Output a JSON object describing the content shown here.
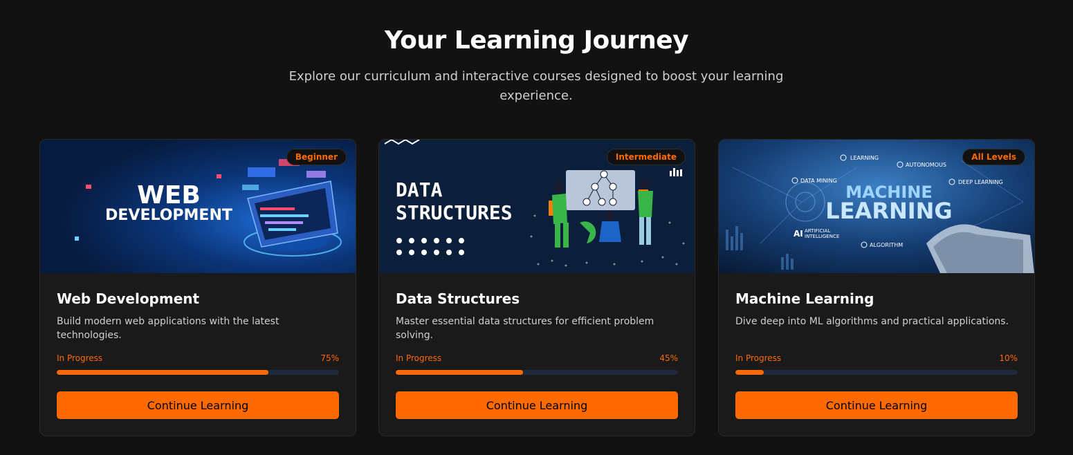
{
  "header": {
    "title": "Your Learning Journey",
    "subtitle": "Explore our curriculum and interactive courses designed to boost your learning experience."
  },
  "courses": [
    {
      "level": "Beginner",
      "image_text": [
        "WEB",
        "DEVELOPMENT"
      ],
      "title": "Web Development",
      "description": "Build modern web applications with the latest technologies.",
      "status": "In Progress",
      "progress_text": "75%",
      "progress": 0.75,
      "button": "Continue Learning"
    },
    {
      "level": "Intermediate",
      "image_text": [
        "DATA",
        "STRUCTURES"
      ],
      "title": "Data Structures",
      "description": "Master essential data structures for efficient problem solving.",
      "status": "In Progress",
      "progress_text": "45%",
      "progress": 0.45,
      "button": "Continue Learning"
    },
    {
      "level": "All Levels",
      "image_text": [
        "MACHINE",
        "LEARNING",
        "LEARNING",
        "AUTONOMOUS",
        "DATA MINING",
        "DEEP LEARNING",
        "ARTIFICIAL",
        "INTELLIGENCE",
        "ALGORITHM",
        "AI"
      ],
      "title": "Machine Learning",
      "description": "Dive deep into ML algorithms and practical applications.",
      "status": "In Progress",
      "progress_text": "10%",
      "progress": 0.1,
      "button": "Continue Learning"
    }
  ],
  "colors": {
    "accent": "#ff6a00",
    "background": "#121212",
    "card": "#1a1a1a",
    "track": "#1e293b"
  }
}
